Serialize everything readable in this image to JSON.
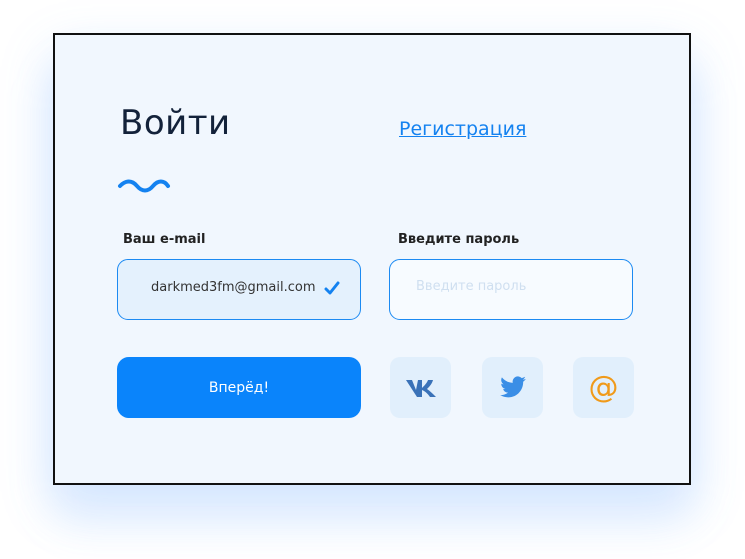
{
  "title": "Войти",
  "register_link": "Регистрация",
  "email": {
    "label": "Ваш e-mail",
    "value": "darkmed3fm@gmail.com",
    "valid": true
  },
  "password": {
    "label": "Введите пароль",
    "placeholder": "Введите пароль"
  },
  "submit_label": "Вперёд!",
  "social": [
    {
      "name": "vk",
      "icon": "vk-icon"
    },
    {
      "name": "twitter",
      "icon": "twitter-icon"
    },
    {
      "name": "mail",
      "icon": "at-sign-icon"
    }
  ],
  "colors": {
    "accent": "#0A84FB",
    "background": "#F1F7FE",
    "title": "#13223A",
    "mail_icon": "#F09A1A"
  }
}
